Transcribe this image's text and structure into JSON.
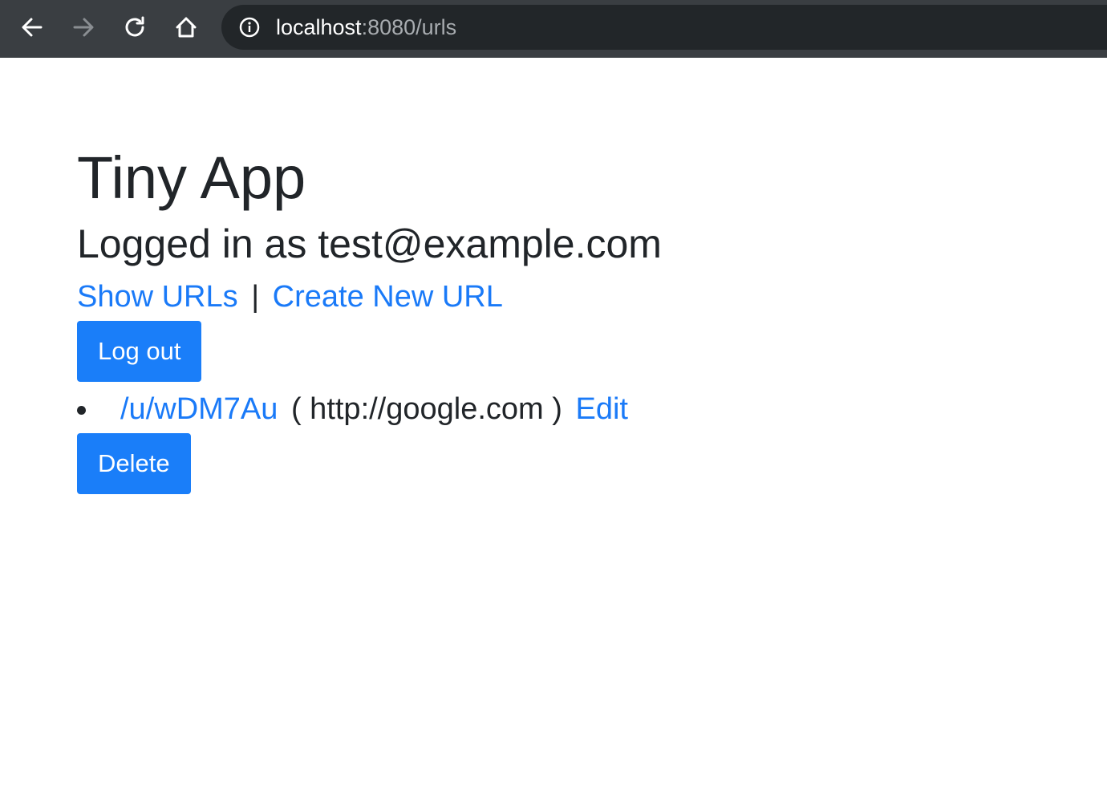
{
  "browser": {
    "url_host": "localhost",
    "url_rest": ":8080/urls"
  },
  "page": {
    "title": "Tiny App",
    "subtitle": "Logged in as test@example.com"
  },
  "nav": {
    "show_urls": "Show URLs",
    "separator": "|",
    "create_new_url": "Create New URL"
  },
  "logout_button": "Log out",
  "urls": [
    {
      "short_link": "/u/wDM7Au",
      "long_url": "( http://google.com )",
      "edit_label": "Edit",
      "delete_label": "Delete"
    }
  ],
  "colors": {
    "link": "#1a7af8",
    "button": "#1a7ef9",
    "browser_bar": "#3a3e42"
  }
}
